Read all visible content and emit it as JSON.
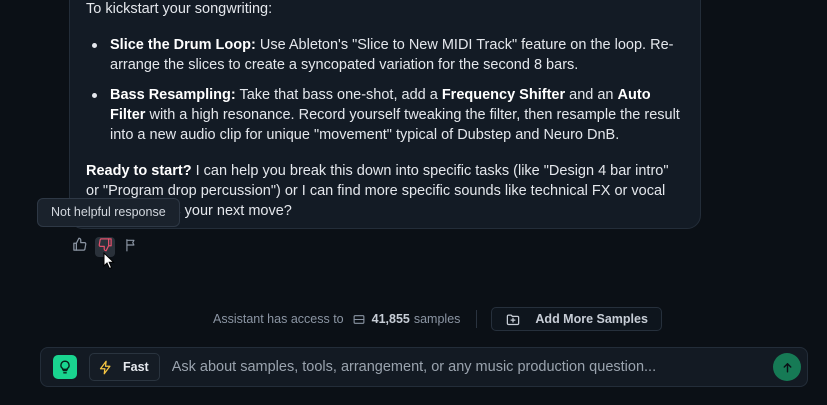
{
  "message": {
    "intro": "To kickstart your songwriting:",
    "bullets": [
      {
        "title": "Slice the Drum Loop:",
        "text": " Use Ableton's \"Slice to New MIDI Track\" feature on the loop. Re-arrange the slices to create a syncopated variation for the second 8 bars."
      },
      {
        "title": "Bass Resampling:",
        "text_a": " Take that bass one-shot, add a ",
        "bold_a": "Frequency Shifter",
        "text_b": " and an ",
        "bold_b": "Auto Filter",
        "text_c": " with a high resonance. Record yourself tweaking the filter, then resample the result into a new audio clip for unique \"movement\" typical of Dubstep and Neuro DnB."
      }
    ],
    "closing_bold": "Ready to start?",
    "closing_text": " I can help you break this down into specific tasks (like \"Design 4 bar intro\" or \"Program drop percussion\") or I can find more specific sounds like technical FX or vocal shouts. What's your next move?"
  },
  "tooltip": "Not helpful response",
  "actions": {
    "icons": [
      "thumbs-up-icon",
      "thumbs-down-icon",
      "flag-icon"
    ],
    "active": "thumbs-down-icon",
    "active_color": "#e0506a"
  },
  "samples": {
    "prefix": "Assistant has access to",
    "count": "41,855",
    "suffix": "samples",
    "add_button": "Add More Samples"
  },
  "composer": {
    "mode_label": "Fast",
    "placeholder": "Ask about samples, tools, arrangement, or any music production question...",
    "accent": "#19d48f"
  }
}
